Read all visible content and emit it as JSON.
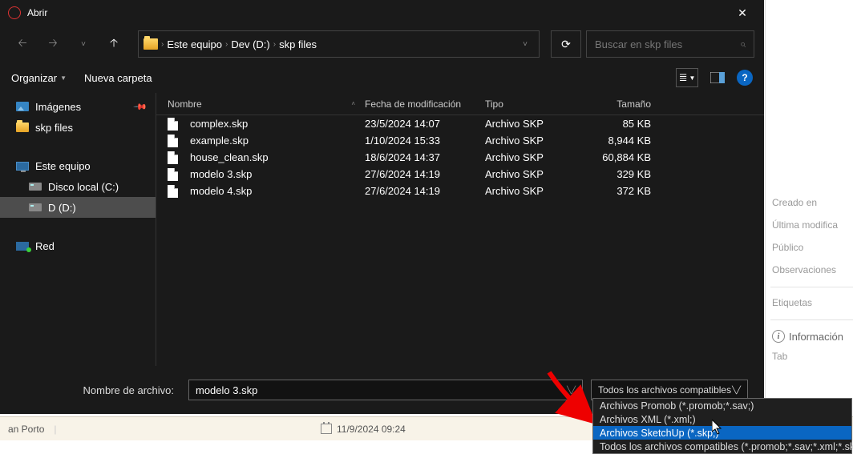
{
  "window": {
    "title": "Abrir"
  },
  "nav": {
    "breadcrumbs": [
      "Este equipo",
      "Dev (D:)",
      "skp files"
    ],
    "search_placeholder": "Buscar en skp files"
  },
  "toolbar": {
    "organize": "Organizar",
    "newfolder": "Nueva carpeta"
  },
  "sidebar": {
    "quick": [
      {
        "label": "Imágenes",
        "pinned": true
      },
      {
        "label": "skp files",
        "pinned": false
      }
    ],
    "thispc": {
      "label": "Este equipo"
    },
    "drives": [
      {
        "label": "Disco local (C:)"
      },
      {
        "label": "D (D:)"
      }
    ],
    "network": {
      "label": "Red"
    }
  },
  "columns": {
    "name": "Nombre",
    "date": "Fecha de modificación",
    "type": "Tipo",
    "size": "Tamaño"
  },
  "files": [
    {
      "name": "complex.skp",
      "date": "23/5/2024 14:07",
      "type": "Archivo SKP",
      "size": "85 KB"
    },
    {
      "name": "example.skp",
      "date": "1/10/2024 15:33",
      "type": "Archivo SKP",
      "size": "8,944 KB"
    },
    {
      "name": "house_clean.skp",
      "date": "18/6/2024 14:37",
      "type": "Archivo SKP",
      "size": "60,884 KB"
    },
    {
      "name": "modelo 3.skp",
      "date": "27/6/2024 14:19",
      "type": "Archivo SKP",
      "size": "329 KB"
    },
    {
      "name": "modelo 4.skp",
      "date": "27/6/2024 14:19",
      "type": "Archivo SKP",
      "size": "372 KB"
    }
  ],
  "footer": {
    "filename_label": "Nombre de archivo:",
    "filename_value": "modelo 3.skp",
    "filter_selected": "Todos los archivos compatibles",
    "filter_options": [
      "Archivos Promob (*.promob;*.sav;)",
      "Archivos XML (*.xml;)",
      "Archivos SketchUp (*.skp;)",
      "Todos los archivos compatibles (*.promob;*.sav;*.xml;*.skp;)"
    ]
  },
  "rightpanel": {
    "created": "Creado en",
    "lastmod": "Última modifica",
    "public": "Público",
    "observations": "Observaciones",
    "tags": "Etiquetas",
    "info": "Información",
    "tab": "Tab"
  },
  "statusbar": {
    "user": "an Porto",
    "datetime": "11/9/2024 09:24"
  }
}
